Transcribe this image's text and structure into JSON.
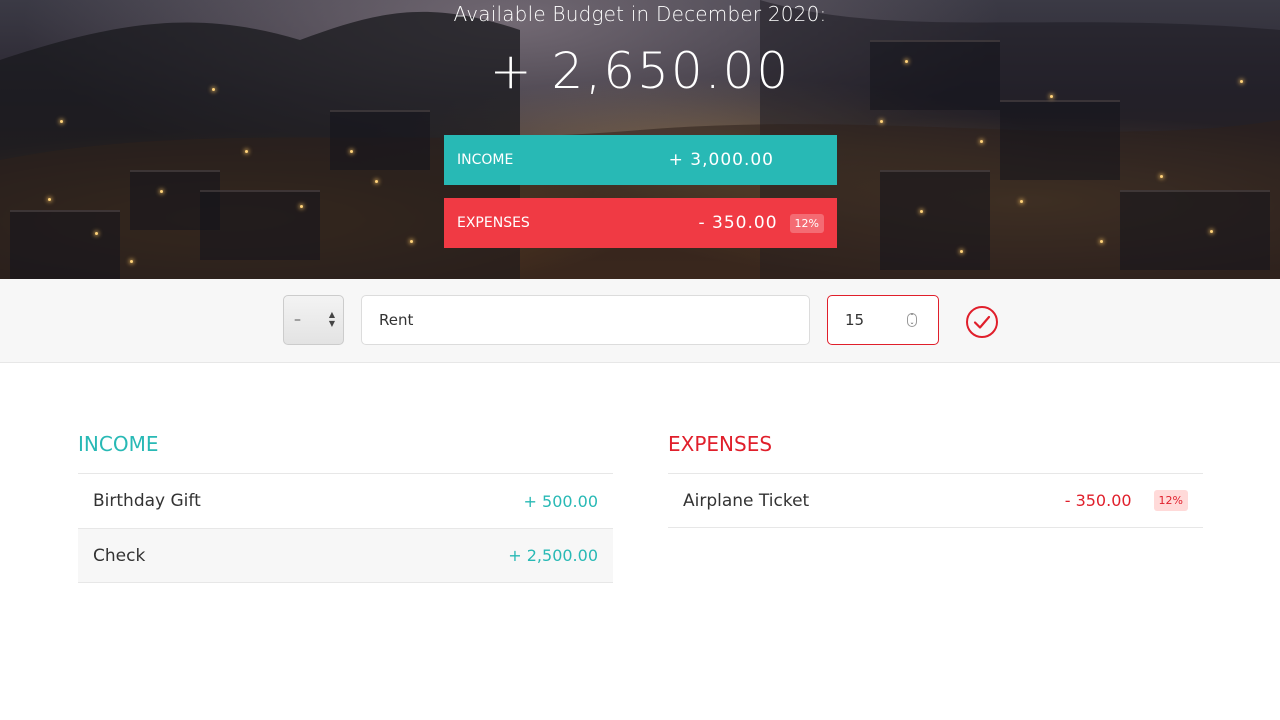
{
  "header": {
    "title": "Available Budget in December 2020:",
    "budget": "+ 2,650.00",
    "income_label": "Income",
    "income_value": "+ 3,000.00",
    "expenses_label": "Expenses",
    "expenses_value": "- 350.00",
    "expenses_percentage": "12%"
  },
  "add_form": {
    "type_value": "–",
    "description_value": "Rent",
    "amount_value": "15",
    "accent_color": "#e01f2b"
  },
  "income_list": {
    "heading": "Income",
    "items": [
      {
        "description": "Birthday Gift",
        "value": "+ 500.00"
      },
      {
        "description": "Check",
        "value": "+ 2,500.00"
      }
    ]
  },
  "expenses_list": {
    "heading": "Expenses",
    "items": [
      {
        "description": "Airplane Ticket",
        "value": "- 350.00",
        "percentage": "12%"
      }
    ]
  },
  "colors": {
    "income": "#28b9b5",
    "expenses": "#e01f2b",
    "expenses_bar": "#f03a44"
  },
  "icons": {
    "add": "check-circle-icon",
    "type_select_arrows": "up-down-arrows-icon"
  }
}
